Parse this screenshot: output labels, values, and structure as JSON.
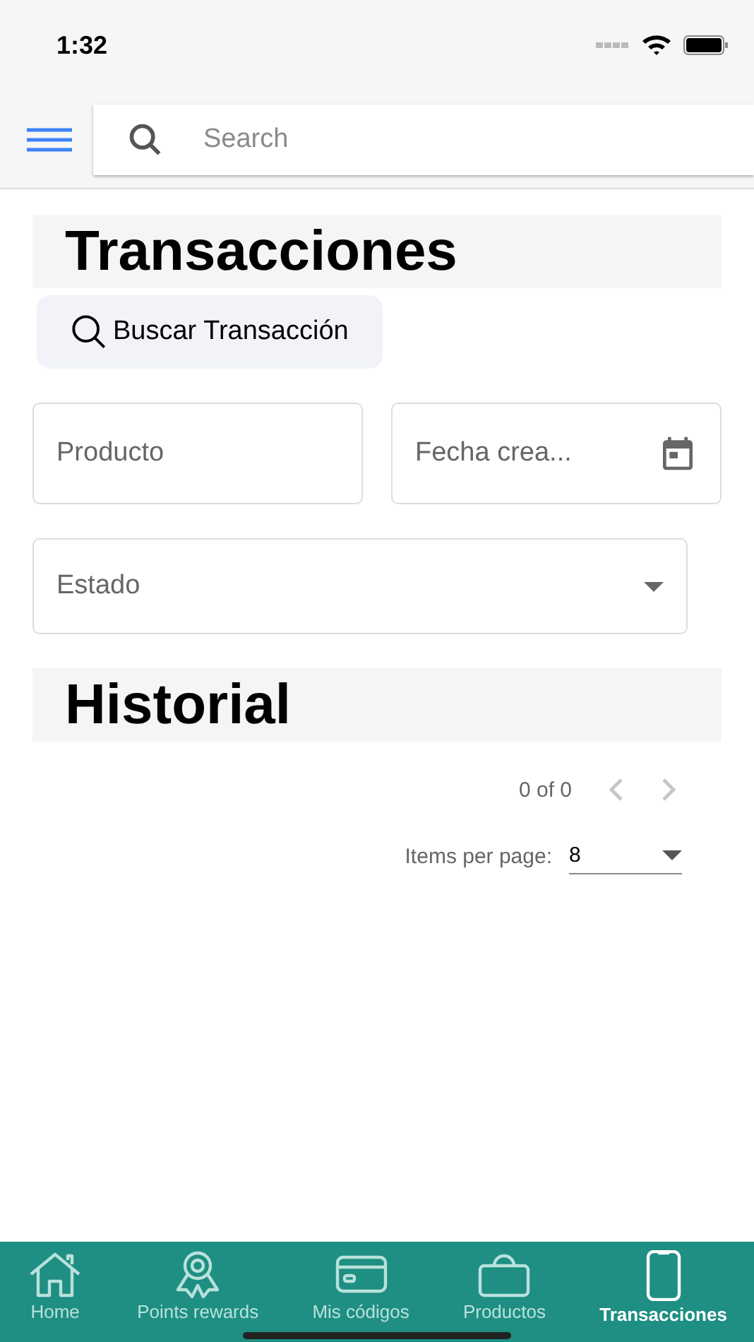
{
  "status_bar": {
    "time": "1:32"
  },
  "search": {
    "placeholder": "Search"
  },
  "title": "Transacciones",
  "search_button": "Buscar Transacción",
  "filters": {
    "product": {
      "placeholder": "Producto"
    },
    "date": {
      "placeholder": "Fecha crea..."
    },
    "status": {
      "placeholder": "Estado"
    }
  },
  "history_title": "Historial",
  "paginator": {
    "range": "0 of 0",
    "items_per_page_label": "Items per page:",
    "items_per_page": "8",
    "prev_disabled": true,
    "next_disabled": true
  },
  "tabs": [
    {
      "kind": "home",
      "label": "Home",
      "selected": false
    },
    {
      "kind": "award",
      "label": "Points rewards",
      "selected": false
    },
    {
      "kind": "card",
      "label": "Mis códigos",
      "selected": false
    },
    {
      "kind": "bag",
      "label": "Productos",
      "selected": false
    },
    {
      "kind": "phone",
      "label": "Transacciones",
      "selected": true
    }
  ]
}
